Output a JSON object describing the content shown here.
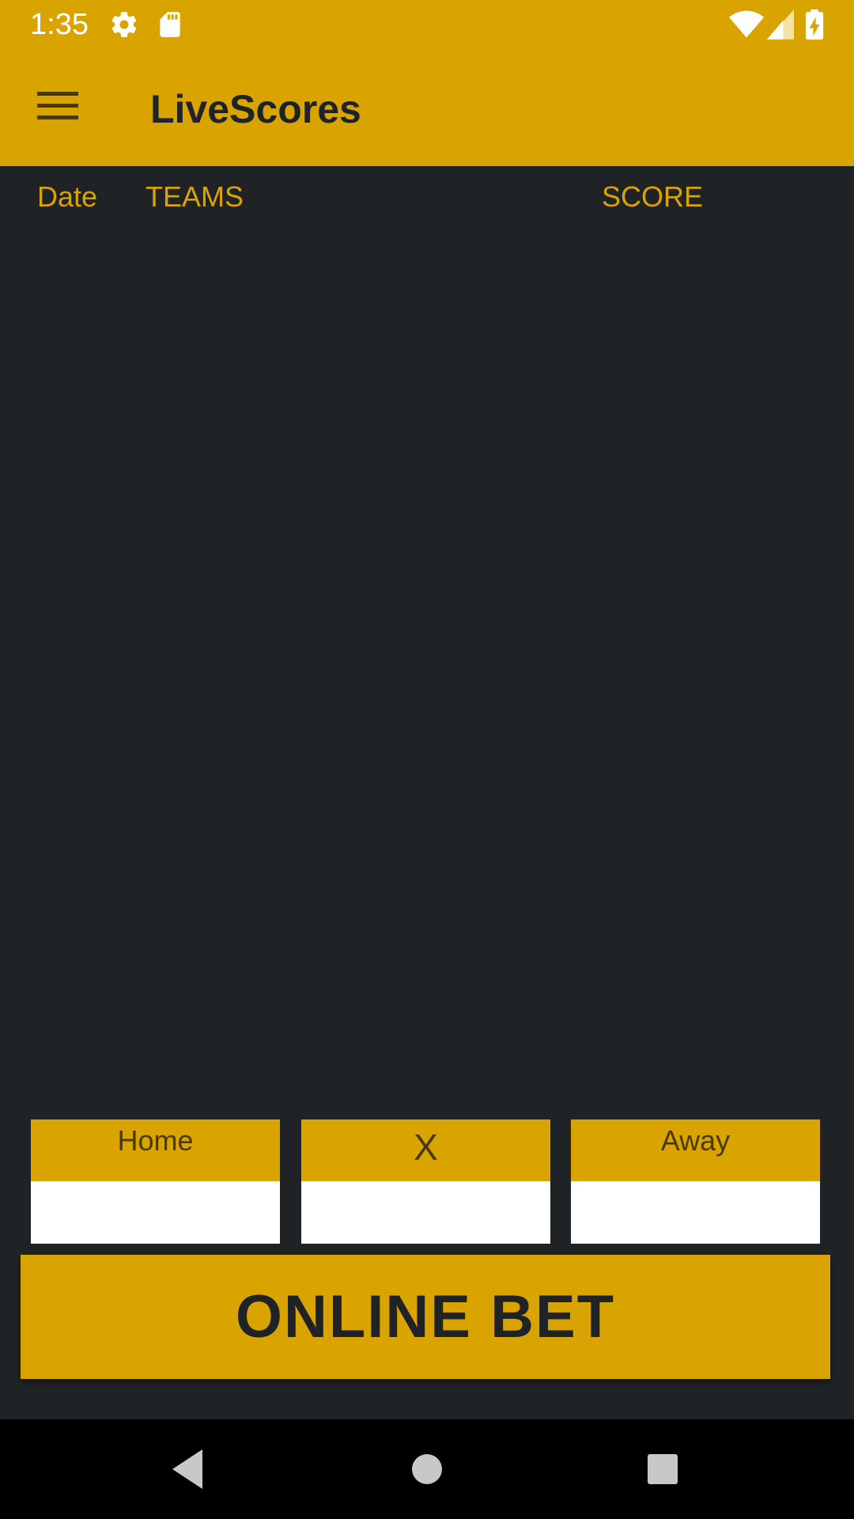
{
  "status_bar": {
    "time": "1:35",
    "icons": [
      "gear-icon",
      "sd-card-icon",
      "wifi-icon",
      "signal-icon",
      "battery-charging-icon"
    ]
  },
  "app_bar": {
    "title": "LiveScores",
    "menu_icon": "hamburger-menu-icon"
  },
  "table_header": {
    "date": "Date",
    "teams": "TEAMS",
    "score": "SCORE"
  },
  "odds": [
    {
      "label": "Home",
      "value": ""
    },
    {
      "label": "X",
      "value": ""
    },
    {
      "label": "Away",
      "value": ""
    }
  ],
  "bet_button": {
    "label": "ONLINE BET"
  },
  "nav_bar": {
    "icons": [
      "back-icon",
      "home-icon",
      "recents-icon"
    ]
  },
  "colors": {
    "accent": "#D9A300",
    "background": "#202326",
    "nav": "#000000"
  }
}
